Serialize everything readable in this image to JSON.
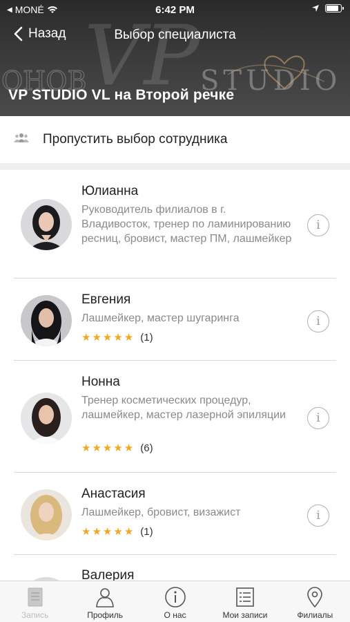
{
  "status_bar": {
    "carrier": "MONÉ",
    "time": "6:42 PM",
    "battery_level": 0.9
  },
  "nav": {
    "back_label": "Назад",
    "title": "Выбор специалиста"
  },
  "branch": {
    "title": "VP STUDIO VL на Второй речке"
  },
  "background_logo": {
    "text_left": "OHOB",
    "text_vp": "VP",
    "text_right": "STUDIO"
  },
  "skip": {
    "label": "Пропустить выбор сотрудника",
    "icon": "group-icon"
  },
  "specialists": [
    {
      "name": "Юлианна",
      "description": "Руководитель филиалов в г. Владивосток, тренер по ламинированию ресниц, бровист, мастер ПМ, лашмейкер",
      "rating": null,
      "reviews": null
    },
    {
      "name": "Евгения",
      "description": "Лашмейкер, мастер шугаринга",
      "rating": 5,
      "reviews": "(1)"
    },
    {
      "name": "Нонна",
      "description": "Тренер косметических процедур, лашмейкер, мастер лазерной эпиляции",
      "rating": 5,
      "reviews": "(6)"
    },
    {
      "name": "Анастасия",
      "description": "Лашмейкер, бровист, визажист",
      "rating": 5,
      "reviews": "(1)"
    },
    {
      "name": "Валерия",
      "description": "",
      "rating": null,
      "reviews": null
    }
  ],
  "tabs": [
    {
      "label": "Запись",
      "icon": "document-icon",
      "active": true
    },
    {
      "label": "Профиль",
      "icon": "profile-icon",
      "active": false
    },
    {
      "label": "О нас",
      "icon": "info-icon",
      "active": false
    },
    {
      "label": "Мои записи",
      "icon": "list-icon",
      "active": false
    },
    {
      "label": "Филиалы",
      "icon": "map-pin-icon",
      "active": false
    }
  ],
  "colors": {
    "star": "#f5a623",
    "header_bg": "#2f2f2f",
    "secondary_text": "#8a8a8a"
  }
}
